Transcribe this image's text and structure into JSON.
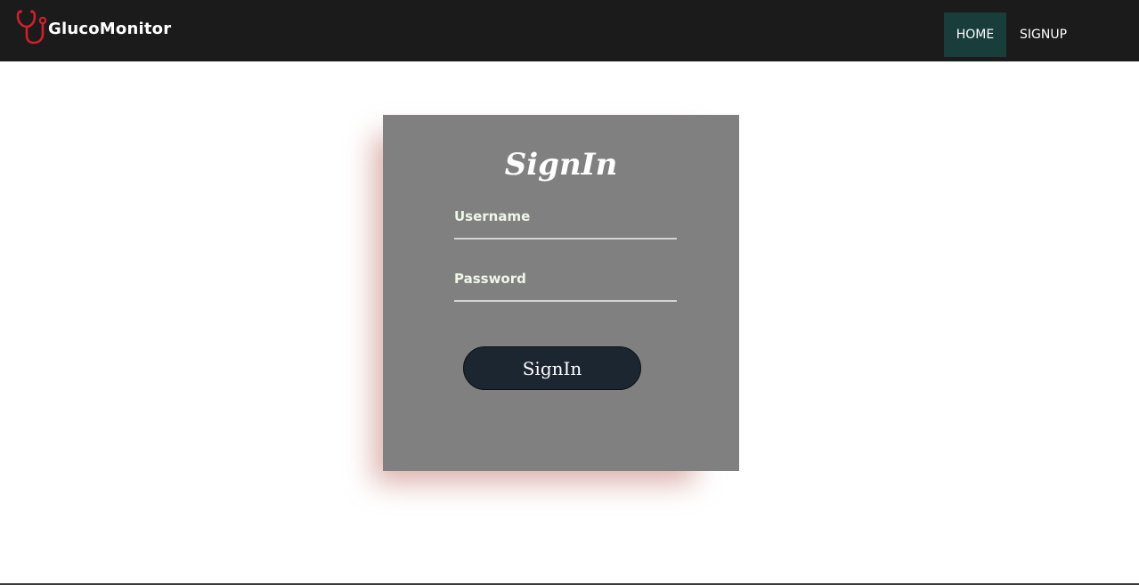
{
  "brand": {
    "name": "GlucoMonitor",
    "logo_icon": "stethoscope-icon",
    "logo_color": "#d21f2c"
  },
  "nav": {
    "items": [
      {
        "label": "HOME",
        "active": true
      },
      {
        "label": "SIGNUP",
        "active": false
      }
    ]
  },
  "signin": {
    "title": "SignIn",
    "username_label": "Username",
    "password_label": "Password",
    "button_label": "SignIn"
  },
  "colors": {
    "navbar": "#1b1b1b",
    "nav_active": "#183d3b",
    "card": "#808080",
    "card_shadow": "#be6e64",
    "button": "#1c2631",
    "label": "#eef6e8"
  }
}
